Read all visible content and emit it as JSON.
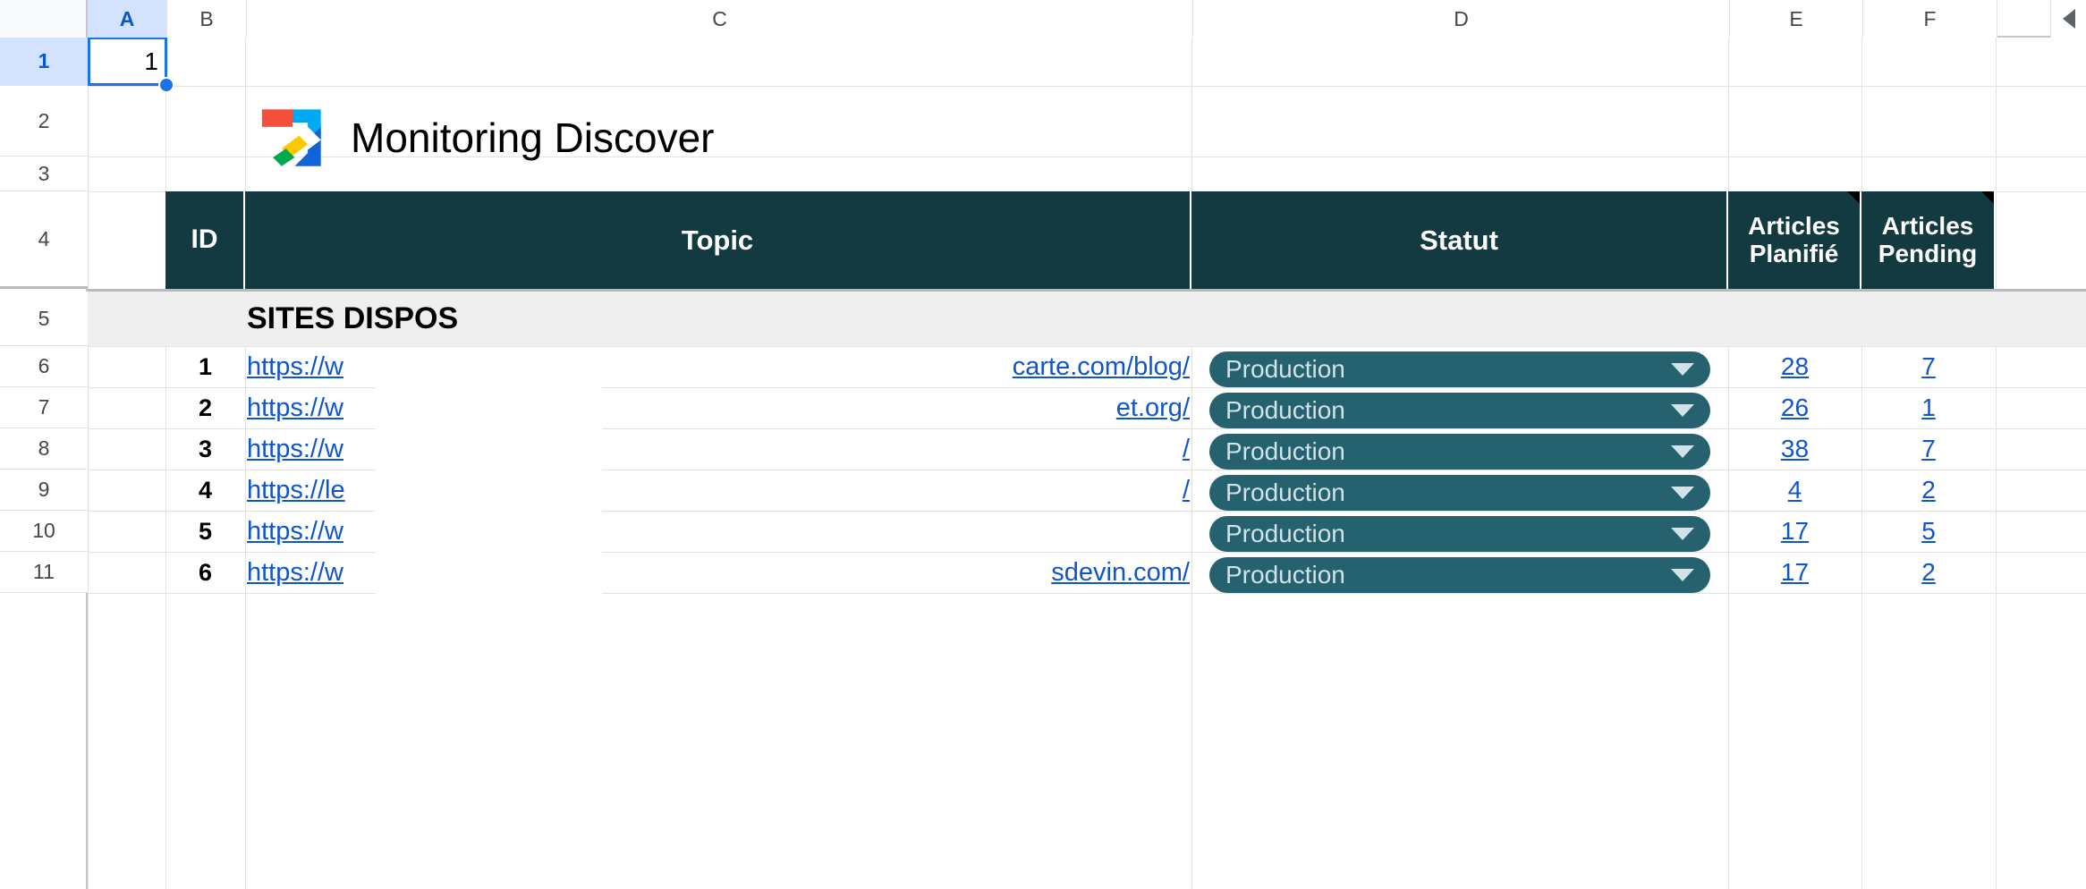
{
  "app": {
    "type": "spreadsheet",
    "selected_cell_ref": "A1",
    "selected_cell_value": "1"
  },
  "columns": [
    {
      "label": "A",
      "selected": true
    },
    {
      "label": "B",
      "selected": false
    },
    {
      "label": "C",
      "selected": false
    },
    {
      "label": "D",
      "selected": false
    },
    {
      "label": "E",
      "selected": false
    },
    {
      "label": "F",
      "selected": false
    }
  ],
  "rows": [
    {
      "label": "1",
      "selected": true
    },
    {
      "label": "2",
      "selected": false
    },
    {
      "label": "3",
      "selected": false
    },
    {
      "label": "4",
      "selected": false
    },
    {
      "label": "5",
      "selected": false
    },
    {
      "label": "6",
      "selected": false
    },
    {
      "label": "7",
      "selected": false
    },
    {
      "label": "8",
      "selected": false
    },
    {
      "label": "9",
      "selected": false
    },
    {
      "label": "10",
      "selected": false
    },
    {
      "label": "11",
      "selected": false
    }
  ],
  "scroll_arrow_icon": "triangle-left-icon",
  "title": {
    "text": "Monitoring Discover",
    "logo_icon": "google-discover-arrow-logo"
  },
  "table": {
    "header_bg": "#123a40",
    "headers": [
      {
        "label": "ID",
        "has_note": false
      },
      {
        "label": "Topic",
        "has_note": false
      },
      {
        "label": "Statut",
        "has_note": false
      },
      {
        "label": "Articles Planifié",
        "has_note": true
      },
      {
        "label": "Articles Pending",
        "has_note": true
      }
    ],
    "section_label": "SITES DISPOS",
    "pill_color": "#26616f",
    "link_color": "#1155cc",
    "rows": [
      {
        "id": "1",
        "url_prefix": "https://w",
        "url_suffix": "carte.com/blog/",
        "statut": "Production",
        "planifie": "28",
        "pending": "7"
      },
      {
        "id": "2",
        "url_prefix": "https://w",
        "url_suffix": "et.org/",
        "statut": "Production",
        "planifie": "26",
        "pending": "1"
      },
      {
        "id": "3",
        "url_prefix": "https://w",
        "url_suffix": "/",
        "statut": "Production",
        "planifie": "38",
        "pending": "7"
      },
      {
        "id": "4",
        "url_prefix": "https://le",
        "url_suffix": "/",
        "statut": "Production",
        "planifie": "4",
        "pending": "2"
      },
      {
        "id": "5",
        "url_prefix": "https://w",
        "url_suffix": "",
        "statut": "Production",
        "planifie": "17",
        "pending": "5"
      },
      {
        "id": "6",
        "url_prefix": "https://w",
        "url_suffix": "sdevin.com/",
        "statut": "Production",
        "planifie": "17",
        "pending": "2"
      }
    ]
  }
}
